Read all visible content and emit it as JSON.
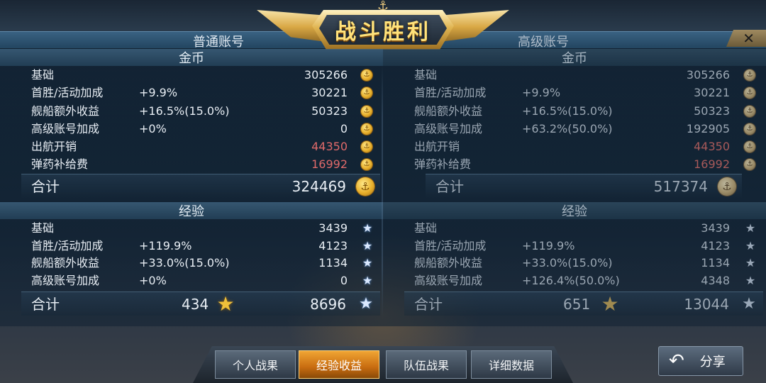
{
  "title": "战斗胜利",
  "close_label": "✕",
  "accounts": {
    "normal": {
      "label": "普通账号",
      "gold": {
        "header": "金币",
        "rows": [
          {
            "label": "基础",
            "pct": "",
            "value": "305266"
          },
          {
            "label": "首胜/活动加成",
            "pct": "+9.9%",
            "value": "30221"
          },
          {
            "label": "舰船额外收益",
            "pct": "+16.5%(15.0%)",
            "value": "50323"
          },
          {
            "label": "高级账号加成",
            "pct": "+0%",
            "value": "0"
          },
          {
            "label": "出航开销",
            "pct": "",
            "value": "44350"
          },
          {
            "label": "弹药补给费",
            "pct": "",
            "value": "16992"
          }
        ],
        "total_label": "合计",
        "total_value": "324469"
      },
      "exp": {
        "header": "经验",
        "rows": [
          {
            "label": "基础",
            "pct": "",
            "value": "3439"
          },
          {
            "label": "首胜/活动加成",
            "pct": "+119.9%",
            "value": "4123"
          },
          {
            "label": "舰船额外收益",
            "pct": "+33.0%(15.0%)",
            "value": "1134"
          },
          {
            "label": "高级账号加成",
            "pct": "+0%",
            "value": "0"
          }
        ],
        "total_label": "合计",
        "captain_exp": "434",
        "total_value": "8696"
      }
    },
    "premium": {
      "label": "高级账号",
      "gold": {
        "header": "金币",
        "rows": [
          {
            "label": "基础",
            "pct": "",
            "value": "305266"
          },
          {
            "label": "首胜/活动加成",
            "pct": "+9.9%",
            "value": "30221"
          },
          {
            "label": "舰船额外收益",
            "pct": "+16.5%(15.0%)",
            "value": "50323"
          },
          {
            "label": "高级账号加成",
            "pct": "+63.2%(50.0%)",
            "value": "192905"
          },
          {
            "label": "出航开销",
            "pct": "",
            "value": "44350"
          },
          {
            "label": "弹药补给费",
            "pct": "",
            "value": "16992"
          }
        ],
        "total_label": "合计",
        "total_value": "517374"
      },
      "exp": {
        "header": "经验",
        "rows": [
          {
            "label": "基础",
            "pct": "",
            "value": "3439"
          },
          {
            "label": "首胜/活动加成",
            "pct": "+119.9%",
            "value": "4123"
          },
          {
            "label": "舰船额外收益",
            "pct": "+33.0%(15.0%)",
            "value": "1134"
          },
          {
            "label": "高级账号加成",
            "pct": "+126.4%(50.0%)",
            "value": "4348"
          }
        ],
        "total_label": "合计",
        "captain_exp": "651",
        "total_value": "13044"
      }
    }
  },
  "tabs": [
    {
      "label": "个人战果",
      "active": false
    },
    {
      "label": "经验收益",
      "active": true
    },
    {
      "label": "队伍战果",
      "active": false
    },
    {
      "label": "详细数据",
      "active": false
    }
  ],
  "share_label": "分享",
  "colors": {
    "negative": "#e06a6a",
    "active_tab": "#e08a20",
    "title_gold": "#ffe27a"
  },
  "icons": [
    "coin-icon",
    "star-icon",
    "gold-star-icon",
    "anchor-icon",
    "share-arrow-icon",
    "close-icon"
  ]
}
